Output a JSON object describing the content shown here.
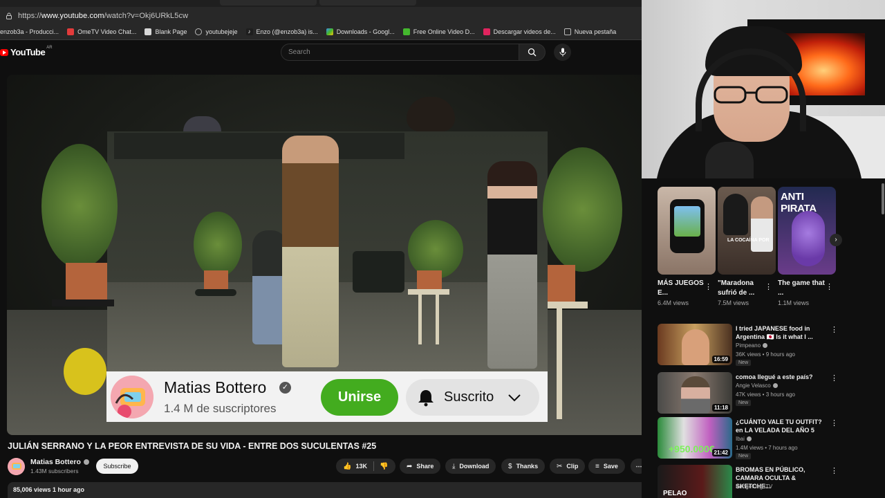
{
  "browser": {
    "url_prefix": "https://",
    "url_host": "www.youtube.com",
    "url_path": "/watch?v=Okj6URkL5cw",
    "bookmarks": [
      {
        "label": "enzob3a - Producci...",
        "color": "#8a8a8a"
      },
      {
        "label": "OmeTV Video Chat...",
        "color": "#e23b3b"
      },
      {
        "label": "Blank Page",
        "color": "#d8d8d8"
      },
      {
        "label": "youtubejeje",
        "color": "#9a9a9a"
      },
      {
        "label": "Enzo (@enzob3a) is...",
        "color": "#1e1e1e"
      },
      {
        "label": "Downloads - Googl...",
        "color": "#3c8df0"
      },
      {
        "label": "Free Online Video D...",
        "color": "#44b82e"
      },
      {
        "label": "Descargar videos de...",
        "color": "#e0245e"
      },
      {
        "label": "Nueva pestaña",
        "color": "#d8d8d8"
      }
    ]
  },
  "header": {
    "logo_text": "YouTube",
    "logo_country": "AR",
    "search_placeholder": "Search"
  },
  "overlay": {
    "channel_name": "Matias Bottero",
    "subscribers": "1.4 M de suscriptores",
    "join_label": "Unirse",
    "subscribed_label": "Suscrito"
  },
  "video": {
    "title": "JULIÁN SERRANO Y LA PEOR ENTREVISTA DE SU VIDA - ENTRE DOS SUCULENTAS #25",
    "channel": "Matias Bottero",
    "channel_subs": "1.43M subscribers",
    "subscribe_label": "Subscribe",
    "likes": "13K",
    "share_label": "Share",
    "download_label": "Download",
    "thanks_label": "Thanks",
    "clip_label": "Clip",
    "save_label": "Save",
    "views_time": "85,006 views  1 hour ago"
  },
  "shorts": [
    {
      "title": "MÁS JUEGOS E...",
      "views": "6.4M views"
    },
    {
      "title": "\"Maradona sufrió de ...",
      "views": "7.5M views",
      "thumb_caption": "LA COCAÍNA POR"
    },
    {
      "title": "The game that ...",
      "views": "1.1M views",
      "thumb_caption": "ANTI PIRATA"
    }
  ],
  "related": [
    {
      "title": "I tried JAPANESE food in Argentina 🇯🇵 Is it what I ...",
      "channel": "Pimpeano",
      "meta": "36K views • 9 hours ago",
      "badge": "New",
      "duration": "16:59"
    },
    {
      "title": "comoa llegué a este país?",
      "channel": "Angie Velasco",
      "meta": "47K views • 3 hours ago",
      "badge": "New",
      "duration": "11:18"
    },
    {
      "title": "¿CUÁNTO VALE TU OUTFIT? en LA VELADA DEL AÑO 5",
      "channel": "Ibai",
      "meta": "1.4M views • 7 hours ago",
      "badge": "New",
      "duration": "21:42",
      "thumb_caption": "+950.000€"
    },
    {
      "title": "BROMAS EN PÚBLICO, CAMARA OCULTA & SKETCHE...",
      "channel": "KringeKingsTV",
      "meta": "",
      "badge": "",
      "duration": "",
      "thumb_caption": "PELAO"
    }
  ]
}
